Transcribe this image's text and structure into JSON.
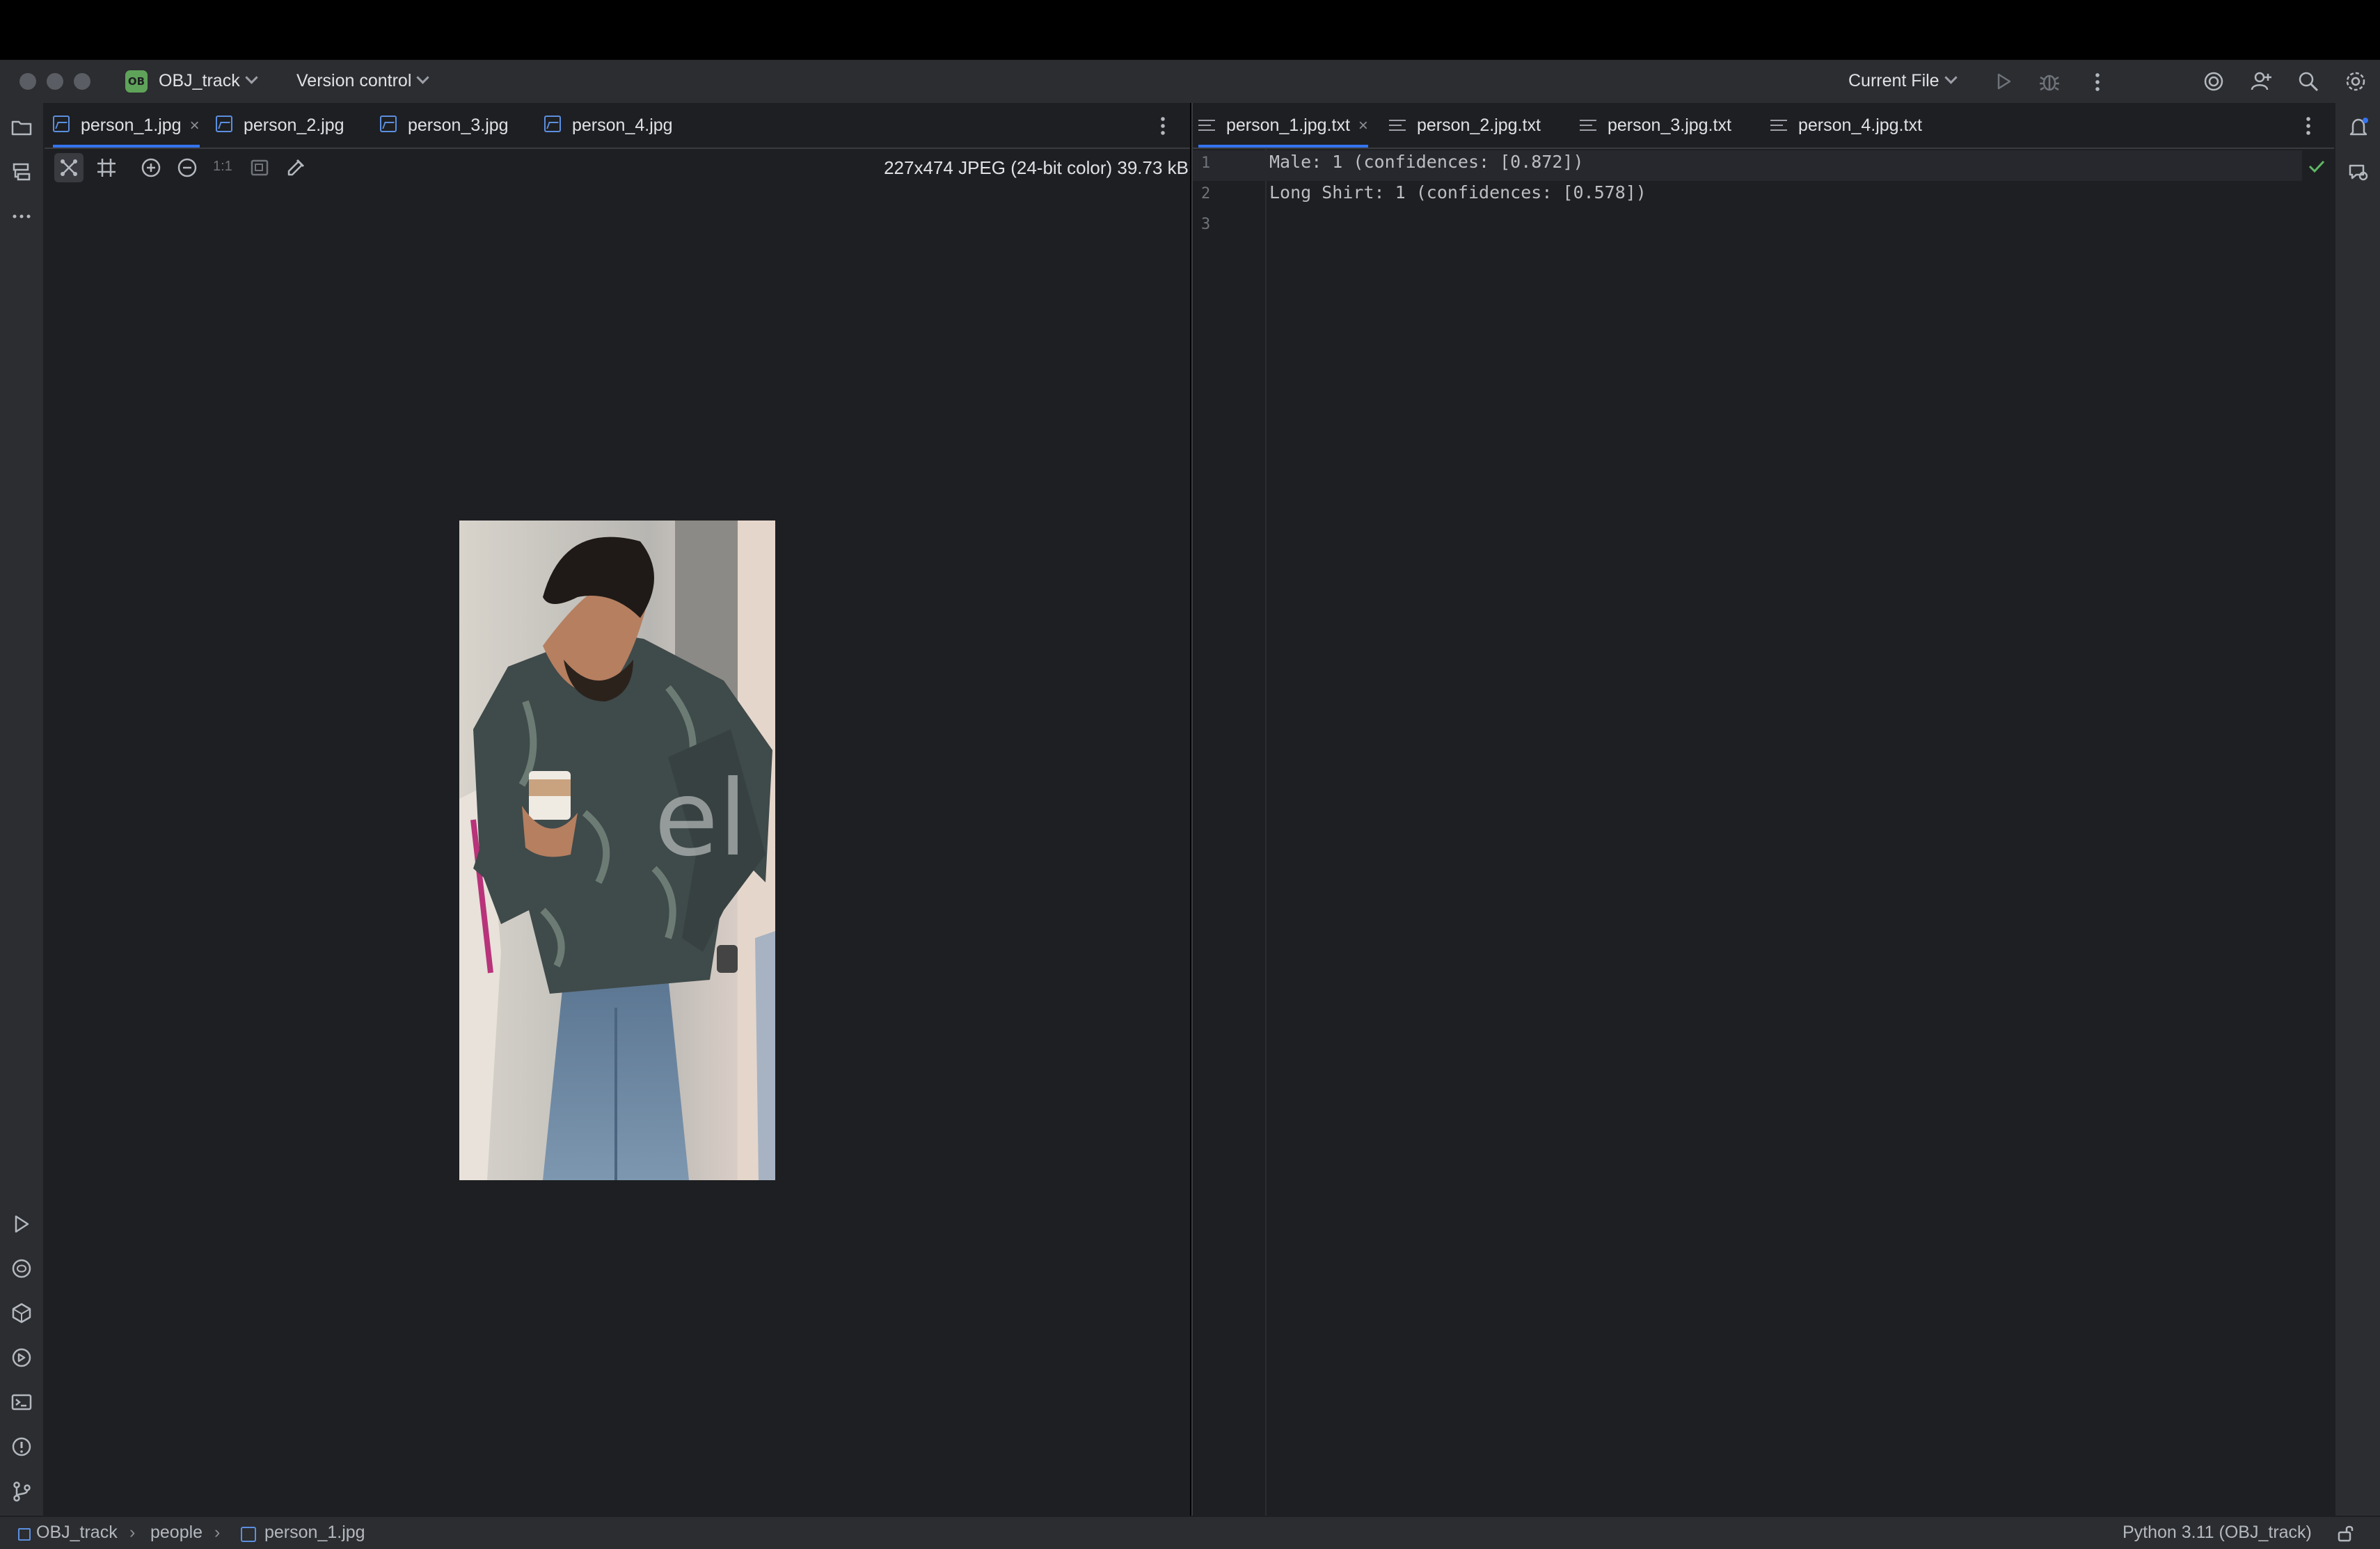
{
  "titlebar": {
    "project_badge": "OB",
    "project_name": "OBJ_track",
    "version_control": "Version control",
    "run_config": "Current File"
  },
  "left_editor": {
    "tabs": [
      {
        "label": "person_1.jpg",
        "active": true,
        "closable": true
      },
      {
        "label": "person_2.jpg",
        "active": false
      },
      {
        "label": "person_3.jpg",
        "active": false
      },
      {
        "label": "person_4.jpg",
        "active": false
      }
    ],
    "image_info": "227x474 JPEG (24-bit color) 39.73 kB",
    "zoom_actual": "1:1",
    "image_watermark": "el"
  },
  "right_editor": {
    "tabs": [
      {
        "label": "person_1.jpg.txt",
        "active": true,
        "closable": true
      },
      {
        "label": "person_2.jpg.txt",
        "active": false
      },
      {
        "label": "person_3.jpg.txt",
        "active": false
      },
      {
        "label": "person_4.jpg.txt",
        "active": false
      }
    ],
    "lines": [
      {
        "number": "1",
        "text": "Male: 1 (confidences: [0.872])"
      },
      {
        "number": "2",
        "text": "Long Shirt: 1 (confidences: [0.578])"
      },
      {
        "number": "3",
        "text": ""
      }
    ]
  },
  "statusbar": {
    "breadcrumb": [
      "OBJ_track",
      "people",
      "person_1.jpg"
    ],
    "interpreter": "Python 3.11 (OBJ_track)"
  },
  "colors": {
    "accent": "#3574f0",
    "editor_bg": "#1e1f22",
    "chrome_bg": "#2b2d30",
    "ok_green": "#5fb865"
  },
  "icons": {
    "left_toolbar": [
      "project-folder-icon",
      "structure-icon",
      "more-icon",
      "run-icon",
      "python-packages-icon",
      "services-icon",
      "python-console-icon",
      "terminal-icon",
      "problems-icon",
      "git-icon"
    ],
    "right_toolbar": [
      "notifications-icon",
      "ai-assistant-icon"
    ],
    "titlebar_right": [
      "run-icon",
      "debug-icon",
      "more-icon",
      "code-with-me-icon",
      "add-user-icon",
      "search-icon",
      "settings-icon"
    ]
  }
}
